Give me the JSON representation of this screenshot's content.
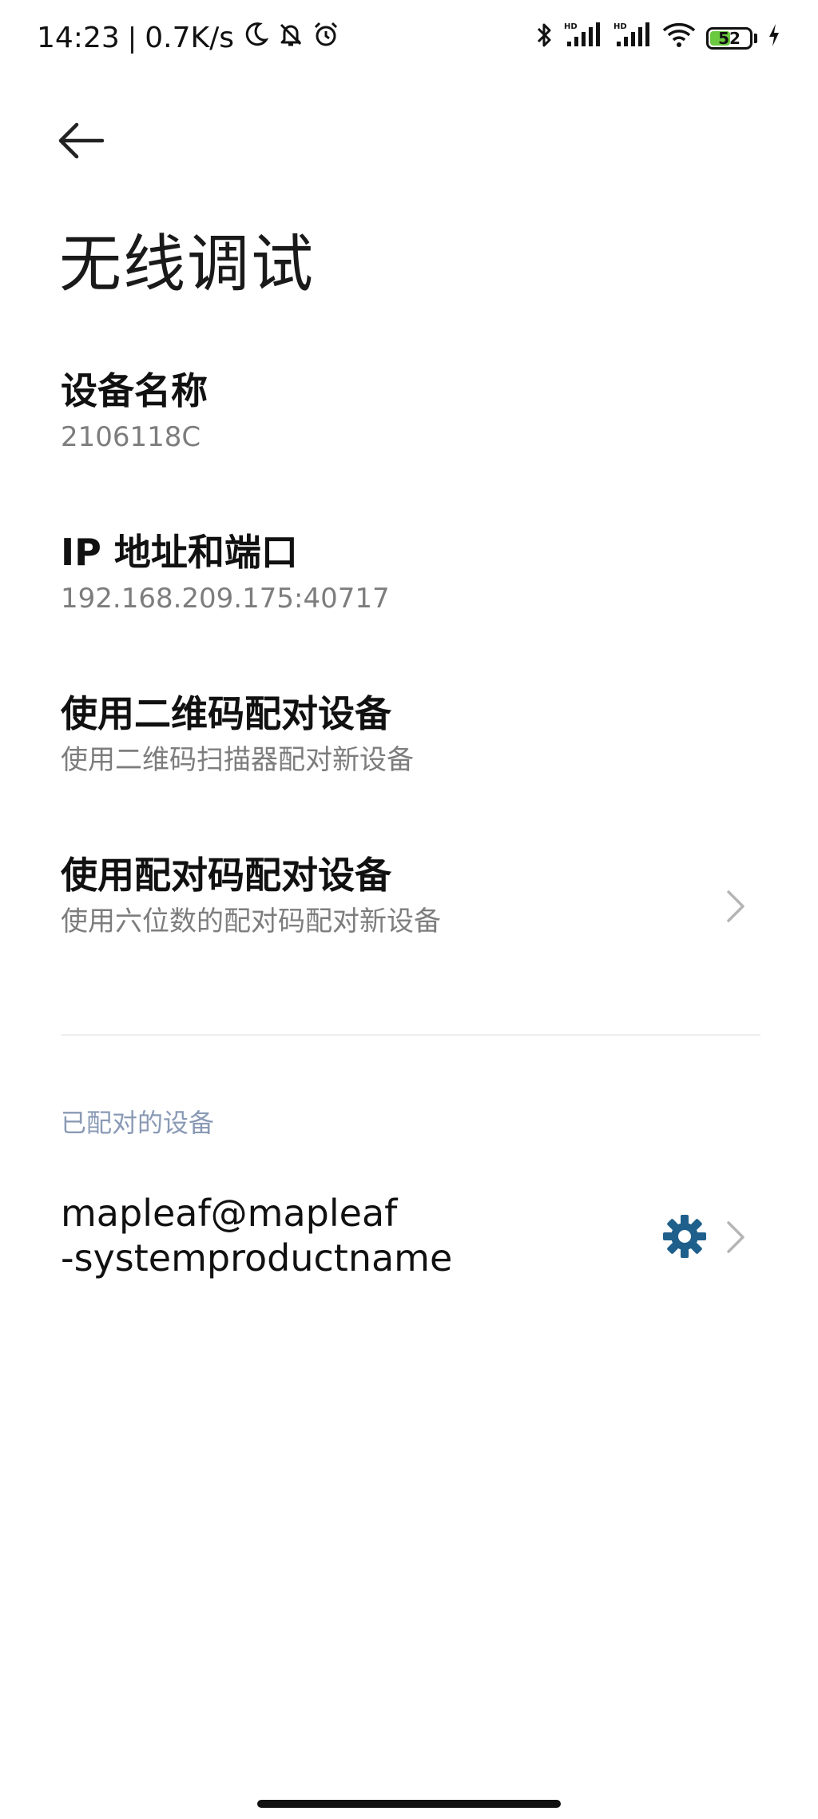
{
  "status_bar": {
    "time": "14:23",
    "separator": "|",
    "net_speed": "0.7K/s",
    "battery_level": "52",
    "battery_percent": 52,
    "icons_left": [
      "moon-icon",
      "bell-off-icon",
      "alarm-icon"
    ],
    "icons_right": [
      "bluetooth-icon",
      "signal-hd-icon",
      "signal-hd-icon",
      "wifi-icon",
      "battery-icon",
      "charging-icon"
    ],
    "signal_label": "HD"
  },
  "header": {
    "title": "无线调试"
  },
  "items": [
    {
      "title": "设备名称",
      "subtitle": "2106118C"
    },
    {
      "title": "IP 地址和端口",
      "subtitle": "192.168.209.175:40717"
    },
    {
      "title": "使用二维码配对设备",
      "subtitle": "使用二维码扫描器配对新设备"
    },
    {
      "title": "使用配对码配对设备",
      "subtitle": "使用六位数的配对码配对新设备"
    }
  ],
  "paired": {
    "section_header": "已配对的设备",
    "device_line1": "mapleaf@mapleaf",
    "device_line2": "-systemproductname"
  },
  "colors": {
    "accent_gear": "#1f5f8b",
    "section_header": "#8a9ab5",
    "subtitle": "#7d7d7d",
    "battery_fill": "#6ac93f"
  }
}
